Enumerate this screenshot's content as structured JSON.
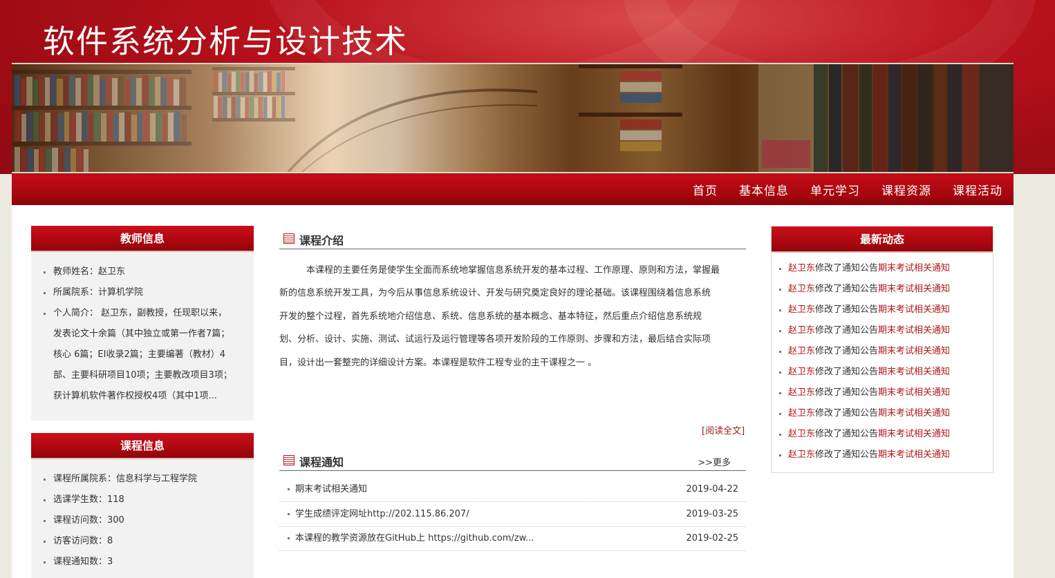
{
  "site": {
    "title": "软件系统分析与设计技术"
  },
  "nav": {
    "items": [
      "首页",
      "基本信息",
      "单元学习",
      "课程资源",
      "课程活动"
    ]
  },
  "teacher": {
    "heading": "教师信息",
    "name": "教师姓名：赵卫东",
    "dept": "所属院系：计算机学院",
    "bio_lines": [
      "个人简介：  赵卫东，副教授，任现职以来，",
      "发表论文十余篇（其中独立或第一作者7篇；",
      "核心 6篇；EI收录2篇；主要编著（教材）4",
      "部、主要科研项目10项；主要教改项目3项；",
      "获计算机软件著作权授权4项（其中1项..."
    ]
  },
  "course": {
    "heading": "课程信息",
    "items": [
      "课程所属院系：信息科学与工程学院",
      "选课学生数：118",
      "课程访问数：300",
      "访客访问数：8",
      "课程通知数：3"
    ]
  },
  "intro": {
    "heading": "课程介绍",
    "lines": [
      "　　　本课程的主要任务是使学生全面而系统地掌握信息系统开发的基本过程、工作原理、原则和方法，掌握最",
      "新的信息系统开发工具，为今后从事信息系统设计、开发与研究奠定良好的理论基础。该课程围绕着信息系统",
      "开发的整个过程，首先系统地介绍信息、系统、信息系统的基本概念、基本特征，然后重点介绍信息系统规",
      "划、分析、设计、实施、测试、试运行及运行管理等各项开发阶段的工作原则、步骤和方法，最后结合实际项",
      "目，设计出一套整完的详细设计方案。本课程是软件工程专业的主干课程之一 。"
    ],
    "read_all": "[阅读全文]"
  },
  "notices": {
    "heading": "课程通知",
    "more": ">>更多",
    "rows": [
      {
        "title": "期末考试相关通知",
        "date": "2019-04-22"
      },
      {
        "title": "学生成绩评定网址http://202.115.86.207/",
        "date": "2019-03-25"
      },
      {
        "title": "本课程的教学资源放在GitHub上 https://github.com/zw...",
        "date": "2019-02-25"
      }
    ]
  },
  "news": {
    "heading": "最新动态",
    "items": [
      {
        "user": "赵卫东",
        "action": "修改了通知公告",
        "link": "期末考试相关通知"
      },
      {
        "user": "赵卫东",
        "action": "修改了通知公告",
        "link": "期末考试相关通知"
      },
      {
        "user": "赵卫东",
        "action": "修改了通知公告",
        "link": "期末考试相关通知"
      },
      {
        "user": "赵卫东",
        "action": "修改了通知公告",
        "link": "期末考试相关通知"
      },
      {
        "user": "赵卫东",
        "action": "修改了通知公告",
        "link": "期末考试相关通知"
      },
      {
        "user": "赵卫东",
        "action": "修改了通知公告",
        "link": "期末考试相关通知"
      },
      {
        "user": "赵卫东",
        "action": "修改了通知公告",
        "link": "期末考试相关通知"
      },
      {
        "user": "赵卫东",
        "action": "修改了通知公告",
        "link": "期末考试相关通知"
      },
      {
        "user": "赵卫东",
        "action": "修改了通知公告",
        "link": "期末考试相关通知"
      },
      {
        "user": "赵卫东",
        "action": "修改了通知公告",
        "link": "期末考试相关通知"
      }
    ]
  }
}
